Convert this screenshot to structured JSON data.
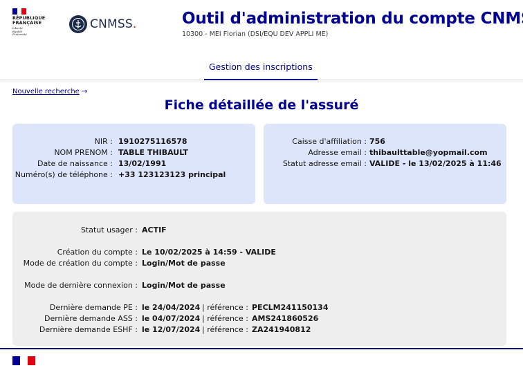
{
  "header": {
    "rf_line1": "RÉPUBLIQUE",
    "rf_line2": "FRANÇAISE",
    "rf_motto1": "Liberté",
    "rf_motto2": "Égalité",
    "rf_motto3": "Fraternité",
    "cnmss_logo_text": "CNMSS",
    "cnmss_logo_dot": ".",
    "title": "Outil d'administration du compte CNMSS",
    "subtitle": "10300 - MEI Florian (DSI/EQU DEV APPLI ME)"
  },
  "nav": {
    "items": [
      {
        "label": "Gestion des inscriptions",
        "active": true
      }
    ]
  },
  "back_link": {
    "label": "Nouvelle recherche",
    "icon": "arrow-right-icon",
    "arrow": "→"
  },
  "page_title": "Fiche détaillée de l'assuré",
  "identity": {
    "nir_label": "NIR :",
    "nir_value": "1910275116578",
    "name_label": "NOM PRENOM :",
    "name_value": "TABLE THIBAULT",
    "birth_label": "Date de naissance :",
    "birth_value": "13/02/1991",
    "phone_label": "Numéro(s) de téléphone :",
    "phone_value": "+33 123123123 principal"
  },
  "contact": {
    "caisse_label": "Caisse d'affiliation :",
    "caisse_value": "756",
    "email_label": "Adresse email :",
    "email_value": "thibaulttable@yopmail.com",
    "email_status_label": "Statut adresse email :",
    "email_status_value": "VALIDE - le 13/02/2025 à 11:46"
  },
  "account": {
    "status_label": "Statut usager :",
    "status_value": "ACTIF",
    "creation_label": "Création du compte :",
    "creation_value": "Le 10/02/2025 à 14:59 - VALIDE",
    "creation_mode_label": "Mode de création du compte :",
    "creation_mode_value": "Login/Mot de passe",
    "last_login_label": "Mode de dernière connexion :",
    "last_login_value": "Login/Mot de passe",
    "requests": [
      {
        "label": "Dernière demande PE :",
        "date": "le 24/04/2024",
        "sep": "| référence :",
        "ref": "PECLM241150134"
      },
      {
        "label": "Dernière demande ASS :",
        "date": "le 04/07/2024",
        "sep": "| référence :",
        "ref": "AMS241860526"
      },
      {
        "label": "Dernière demande ESHF :",
        "date": "le 12/07/2024",
        "sep": "| référence :",
        "ref": "ZA241940812"
      }
    ]
  },
  "colors": {
    "primary": "#000091",
    "card_blue": "#dde5fa",
    "card_grey": "#eeeeee",
    "marianne_red": "#e1000f"
  }
}
